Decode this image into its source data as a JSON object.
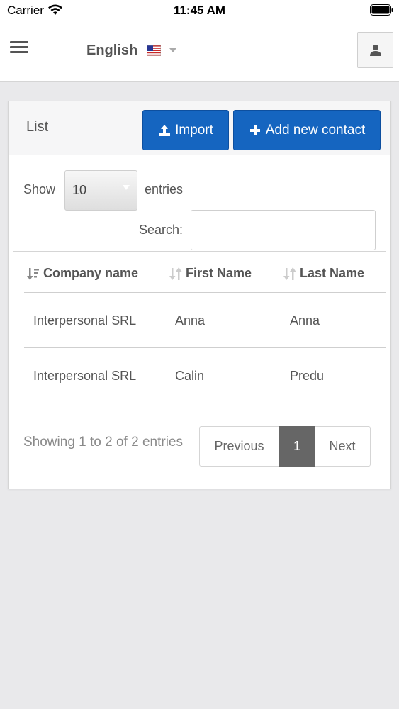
{
  "status_bar": {
    "carrier": "Carrier",
    "time": "11:45 AM"
  },
  "header": {
    "language": "English",
    "flag": "us-flag-icon",
    "user_icon": "user-icon"
  },
  "panel": {
    "title": "List",
    "import_label": "Import",
    "add_contact_label": "Add new contact"
  },
  "table_controls": {
    "show_label": "Show",
    "page_length": "10",
    "entries_label": "entries",
    "search_label": "Search:",
    "search_value": ""
  },
  "table": {
    "columns": [
      "Company name",
      "First Name",
      "Last Name"
    ],
    "rows": [
      [
        "Interpersonal SRL",
        "Anna",
        "Anna"
      ],
      [
        "Interpersonal SRL",
        "Calin",
        "Predu"
      ]
    ]
  },
  "footer": {
    "info": "Showing 1 to 2 of 2 entries",
    "previous": "Previous",
    "current_page": "1",
    "next": "Next"
  },
  "colors": {
    "primary": "#1565c0",
    "active_page": "#666666",
    "background": "#e9e9eb"
  }
}
